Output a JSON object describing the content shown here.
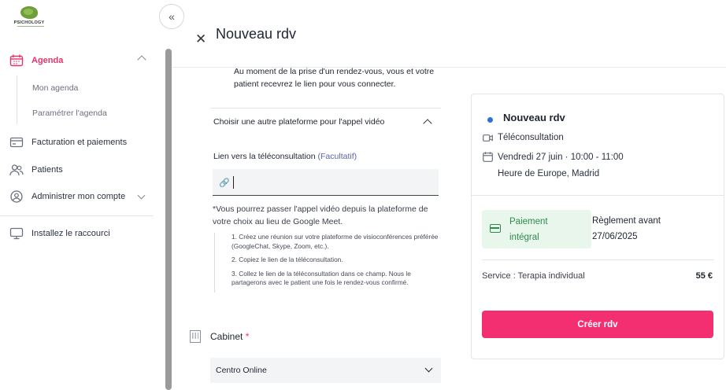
{
  "logo": {
    "text": "PSICHOLOGY"
  },
  "sidebar": {
    "collapse_icon": "chevrons-left-icon",
    "items": [
      {
        "label": "Agenda",
        "icon": "calendar-icon",
        "active": true
      },
      {
        "label": "Facturation et paiements",
        "icon": "credit-card-icon"
      },
      {
        "label": "Patients",
        "icon": "users-icon"
      },
      {
        "label": "Administrer mon compte",
        "icon": "user-circle-icon"
      },
      {
        "label": "Installez le raccourci",
        "icon": "monitor-icon"
      }
    ],
    "subitems": [
      {
        "label": "Mon agenda"
      },
      {
        "label": "Paramétrer l'agenda"
      }
    ]
  },
  "header": {
    "title": "Nouveau rdv"
  },
  "form": {
    "intro": "Au moment de la prise d'un rendez-vous, vous et votre patient recevrez le lien pour vous connecter.",
    "accordion_title": "Choisir une autre plateforme pour l'appel vidéo",
    "link_label": "Lien vers la téléconsultation",
    "link_optional": "(Facultatif)",
    "link_value": "",
    "note": "*Vous pourrez passer l'appel vidéo depuis la plateforme de votre choix au lieu de Google Meet.",
    "steps": [
      "1. Créez une réunion sur votre plateforme de visioconférences préférée (GoogleChat, Skype, Zoom, etc.).",
      "2. Copiez le lien de la téléconsultation.",
      "3. Collez le lien de la téléconsultation dans ce champ. Nous le partagerons avec le patient une fois le rendez-vous confirmé."
    ],
    "cabinet_label": "Cabinet",
    "cabinet_required": "*",
    "cabinet_value": "Centro Online"
  },
  "summary": {
    "title": "Nouveau rdv",
    "type": "Téléconsultation",
    "datetime": "Vendredi 27 juin · 10:00 - 11:00",
    "timezone": "Heure de Europe, Madrid",
    "payment_line1": "Paiement",
    "payment_line2": "intégral",
    "reglement_line1": "Règlement avant",
    "reglement_line2": "27/06/2025",
    "service": "Service : Terapia individual",
    "price": "55 €",
    "cta": "Créer rdv",
    "accent": "#f32f72"
  }
}
